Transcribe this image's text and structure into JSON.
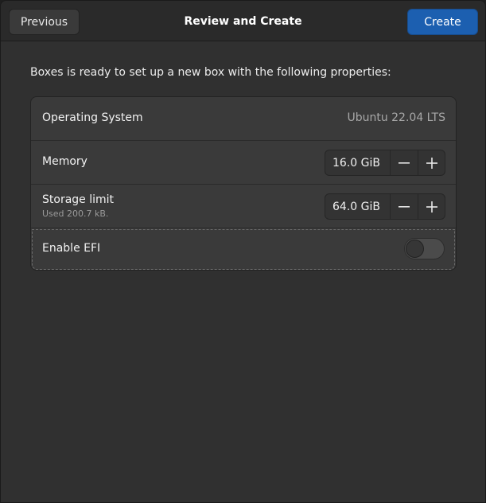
{
  "header": {
    "title": "Review and Create",
    "previous_label": "Previous",
    "create_label": "Create"
  },
  "intro_text": "Boxes is ready to set up a new box with the following properties:",
  "properties": {
    "os": {
      "label": "Operating System",
      "value": "Ubuntu 22.04 LTS"
    },
    "memory": {
      "label": "Memory",
      "value": "16.0  GiB"
    },
    "storage": {
      "label": "Storage limit",
      "sublabel": "Used 200.7  kB.",
      "value": "64.0  GiB"
    },
    "efi": {
      "label": "Enable EFI",
      "enabled": false
    }
  },
  "colors": {
    "accent": "#1c5fb0",
    "window_bg": "#303030",
    "card_bg": "#3a3a3a"
  },
  "icons": {
    "decrement": "minus-icon",
    "increment": "plus-icon"
  }
}
